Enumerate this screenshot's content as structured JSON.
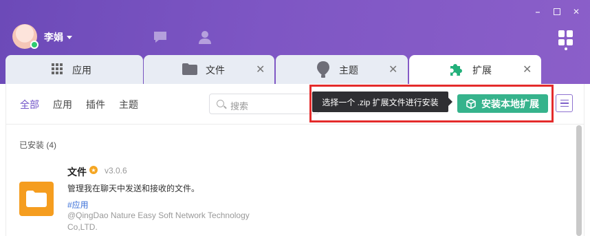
{
  "user": {
    "name": "李娟",
    "status_color": "#2ecc71"
  },
  "window_controls": {
    "minimize": "–",
    "maximize": "",
    "close": "✕"
  },
  "tabs": [
    {
      "label": "应用",
      "icon": "grid-icon",
      "closable": false,
      "active": false
    },
    {
      "label": "文件",
      "icon": "folder-icon",
      "closable": true,
      "active": false
    },
    {
      "label": "主题",
      "icon": "balloon-icon",
      "closable": true,
      "active": false
    },
    {
      "label": "扩展",
      "icon": "puzzle-icon",
      "closable": true,
      "active": true
    }
  ],
  "filters": [
    "全部",
    "应用",
    "插件",
    "主题"
  ],
  "search": {
    "placeholder": "搜索"
  },
  "tooltip": "选择一个 .zip 扩展文件进行安装",
  "install_button": "安装本地扩展",
  "installed": {
    "title": "已安装 (4)",
    "items": [
      {
        "name": "文件",
        "version": "v3.0.6",
        "description": "管理我在聊天中发送和接收的文件。",
        "tag": "#应用",
        "author": "@QingDao Nature Easy Soft Network Technology Co,LTD."
      }
    ]
  },
  "colors": {
    "accent": "#7154c8",
    "install": "#36b38c",
    "highlight": "#e42b2b",
    "folder": "#f59d1f"
  }
}
